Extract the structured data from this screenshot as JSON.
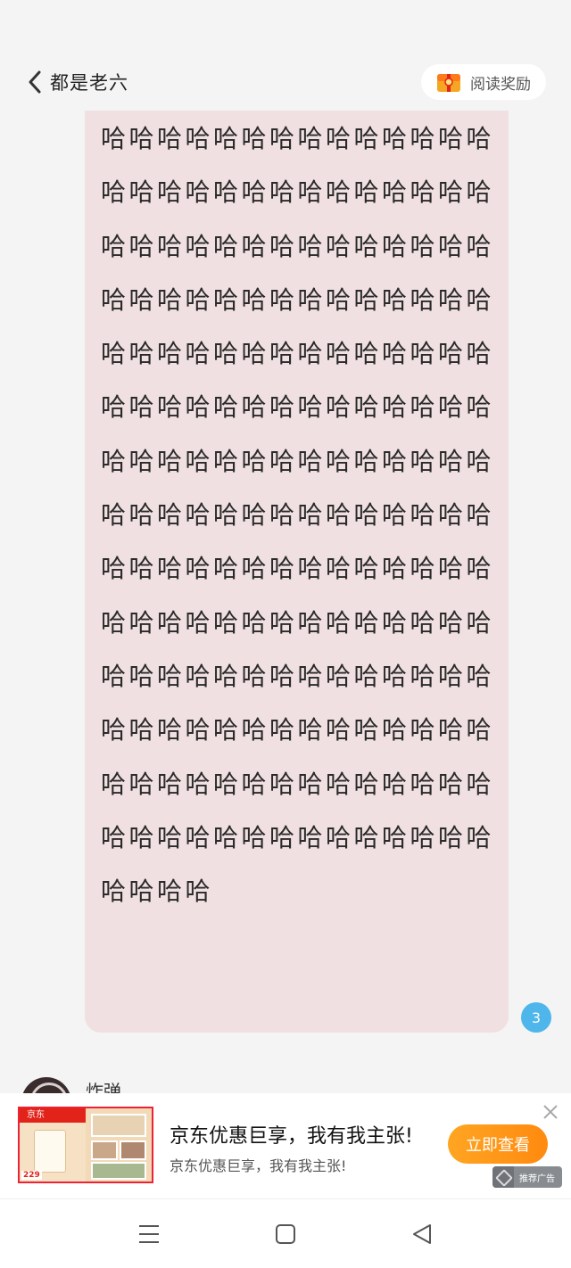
{
  "header": {
    "title": "都是老六",
    "reward_label": "阅读奖励",
    "reward_icon": "gift-box-icon"
  },
  "message": {
    "text": "哈哈哈哈哈哈哈哈哈哈哈哈哈哈哈哈哈哈哈哈哈哈哈哈哈哈哈哈哈哈哈哈哈哈哈哈哈哈哈哈哈哈哈哈哈哈哈哈哈哈哈哈哈哈哈哈哈哈哈哈哈哈哈哈哈哈哈哈哈哈哈哈哈哈哈哈哈哈哈哈哈哈哈哈哈哈哈哈哈哈哈哈哈哈哈哈哈哈哈哈哈哈哈哈哈哈哈哈哈哈哈哈哈哈哈哈哈哈哈哈哈哈哈哈哈哈哈哈哈哈哈哈哈哈哈哈哈哈哈哈哈哈哈哈哈哈哈哈哈哈哈哈哈哈哈哈哈哈哈哈哈哈哈哈哈哈哈哈哈哈哈哈哈哈哈哈哈哈哈哈哈哈哈哈哈哈哈哈哈哈哈哈哈哈哈哈哈哈哈哈",
    "count": "3",
    "bubble_color": "#f1e0e1"
  },
  "next_message": {
    "name": "炸弹"
  },
  "ad": {
    "thumb_logo": "京东",
    "thumb_price": "229",
    "title": "京东优惠巨享，我有我主张!",
    "description": "京东优惠巨享，我有我主张!",
    "cta_label": "立即查看",
    "tag_label": "推荐广告",
    "cta_color": "#ff9a1a"
  },
  "navbar": {
    "icons": [
      "menu-icon",
      "home-square-icon",
      "back-triangle-icon"
    ]
  }
}
